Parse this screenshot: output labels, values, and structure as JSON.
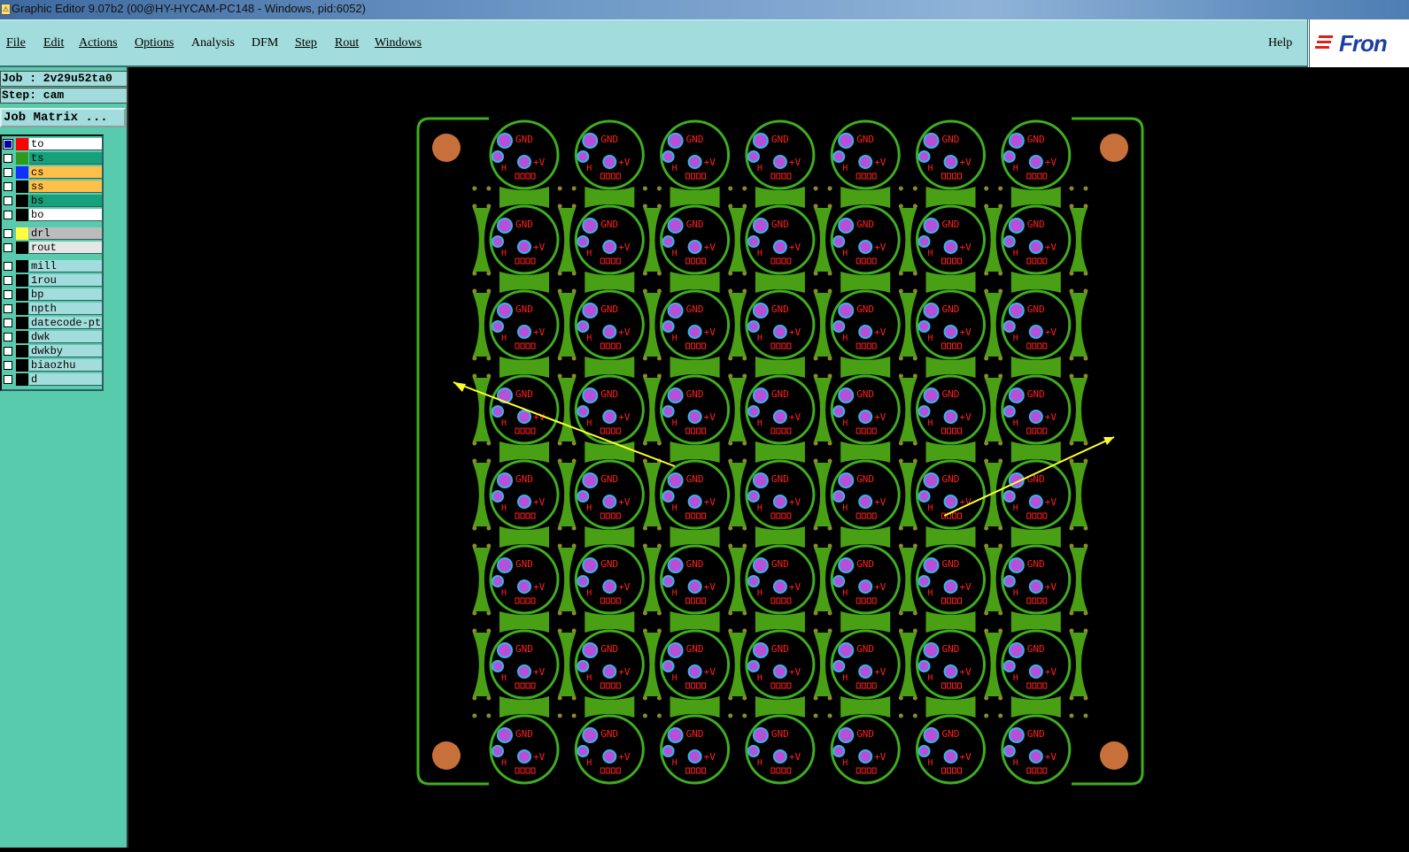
{
  "titlebar": {
    "title": "Graphic Editor 9.07b2 (00@HY-HYCAM-PC148 - Windows, pid:6052)",
    "icon": "app-icon"
  },
  "menu": {
    "items": [
      {
        "label": "File"
      },
      {
        "label": "Edit"
      },
      {
        "label": "Actions"
      },
      {
        "label": "Options"
      },
      {
        "label": "Analysis"
      },
      {
        "label": "DFM"
      },
      {
        "label": "Step"
      },
      {
        "label": "Rout"
      },
      {
        "label": "Windows"
      }
    ],
    "help": "Help",
    "logo": "Fron"
  },
  "job": {
    "job_label": "Job : 2v29u52ta0",
    "step_label": "Step: cam",
    "matrix_button": "Job Matrix ..."
  },
  "layers": [
    {
      "name": "to",
      "swatch": "#ff0000",
      "bg": "#ffffff",
      "checked": true
    },
    {
      "name": "ts",
      "swatch": "#2e9a1e",
      "bg": "#18a07a",
      "checked": false
    },
    {
      "name": "cs",
      "swatch": "#1030ff",
      "bg": "#ffc04a",
      "checked": false
    },
    {
      "name": "ss",
      "swatch": "#000000",
      "bg": "#ffc04a",
      "checked": false
    },
    {
      "name": "bs",
      "swatch": "#000000",
      "bg": "#18a07a",
      "checked": false
    },
    {
      "name": "bo",
      "swatch": "#000000",
      "bg": "#ffffff",
      "checked": false
    },
    {
      "name": "drl",
      "swatch": "#ffff40",
      "bg": "#bcbcbc",
      "checked": false
    },
    {
      "name": "rout",
      "swatch": "#000000",
      "bg": "#e6e6e6",
      "checked": false
    },
    {
      "name": "mill",
      "swatch": "#000000",
      "bg": "#a3dcdc",
      "checked": false
    },
    {
      "name": "1rou",
      "swatch": "#000000",
      "bg": "#a3dcdc",
      "checked": false
    },
    {
      "name": "bp",
      "swatch": "#000000",
      "bg": "#a3dcdc",
      "checked": false
    },
    {
      "name": "npth",
      "swatch": "#000000",
      "bg": "#a3dcdc",
      "checked": false
    },
    {
      "name": "datecode-ptc",
      "swatch": "#000000",
      "bg": "#a3dcdc",
      "checked": false
    },
    {
      "name": "dwk",
      "swatch": "#000000",
      "bg": "#a3dcdc",
      "checked": false
    },
    {
      "name": "dwkby",
      "swatch": "#000000",
      "bg": "#a3dcdc",
      "checked": false
    },
    {
      "name": "biaozhu",
      "swatch": "#000000",
      "bg": "#a3dcdc",
      "checked": false
    },
    {
      "name": "d",
      "swatch": "#000000",
      "bg": "#a3dcdc",
      "checked": false
    }
  ],
  "board": {
    "rows": 8,
    "cols": 7,
    "pad_gnd": "GND",
    "pad_v": "+V",
    "pad_h": "H",
    "colors": {
      "copper": "#4aa014",
      "outline": "#3fae1f",
      "text": "#ff1f1f",
      "pad": "#b84fd8",
      "ring": "#2fb8e8",
      "hole": "#c8703c",
      "arrow": "#ffff30"
    }
  }
}
